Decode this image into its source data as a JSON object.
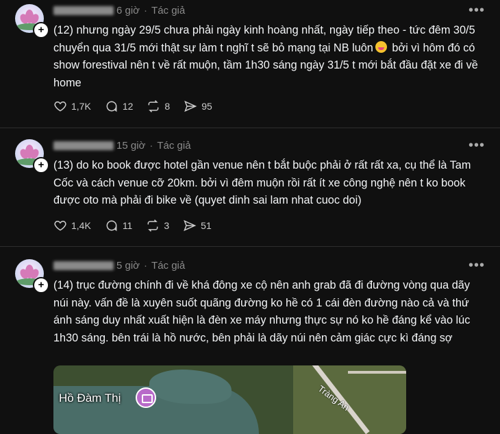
{
  "posts": [
    {
      "time": "6 giờ",
      "author_tag": "Tác giả",
      "text": "(12) nhưng ngày 29/5 chưa phải ngày kinh hoàng nhất, ngày tiếp theo - tức đêm 30/5 chuyển qua 31/5 mới thật sự làm t nghĩ t sẽ bỏ mạng tại NB luôn",
      "text_after_emoji": " bởi vì hôm đó có show forestival nên t về rất muộn, tầm 1h30 sáng ngày 31/5 t mới bắt đầu đặt xe đi về home",
      "likes": "1,7K",
      "replies": "12",
      "reposts": "8",
      "shares": "95"
    },
    {
      "time": "15 giờ",
      "author_tag": "Tác giả",
      "text": "(13) do ko book được hotel gần venue nên t bắt buộc phải ở rất rất xa, cụ thể là Tam Cốc và cách venue cỡ 20km. bởi vì đêm muộn rồi rất ít xe công nghệ nên t ko book được oto mà phải đi bike về (quyet dinh sai lam nhat cuoc doi)",
      "likes": "1,4K",
      "replies": "11",
      "reposts": "3",
      "shares": "51"
    },
    {
      "time": "5 giờ",
      "author_tag": "Tác giả",
      "text": "(14) trục đường chính đi về khá đông xe cộ nên anh grab đã đi đường vòng qua dãy núi này. vấn đề là xuyên suốt quãng đường ko hề có 1 cái đèn đường nào cả và thứ ánh sáng duy nhất xuất hiện là đèn xe máy nhưng thực sự nó ko hề đáng kể vào lúc 1h30 sáng. bên trái là hồ nước, bên phải là dãy núi nên cảm giác cực kì đáng sợ",
      "map_place": "Hồ Đàm Thị",
      "map_street": "Tràng An"
    }
  ],
  "icons": [
    "heart-icon",
    "comment-icon",
    "repost-icon",
    "share-icon",
    "more-icon",
    "follow-plus-icon"
  ]
}
